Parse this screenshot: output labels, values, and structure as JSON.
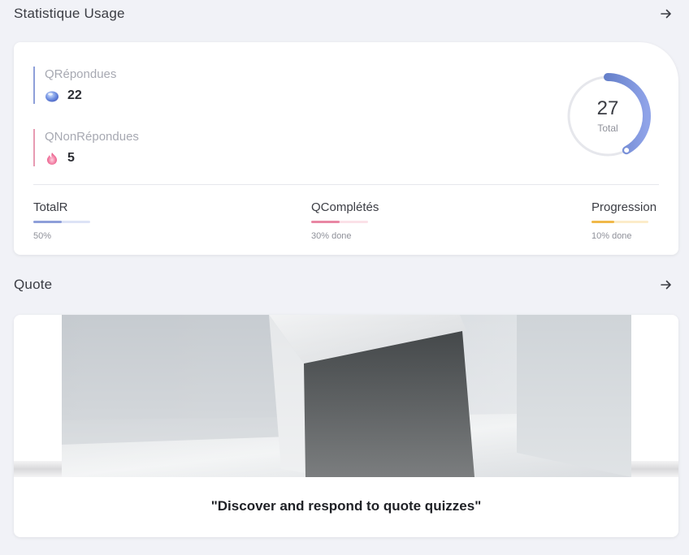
{
  "stats_section": {
    "title": "Statistique Usage",
    "arrow_icon": "arrow-right-icon"
  },
  "stats": [
    {
      "label": "QRépondues",
      "value": "22",
      "icon": "blue-orb-icon",
      "color": "#7d8fd6"
    },
    {
      "label": "QNonRépondues",
      "value": "5",
      "icon": "pink-flame-icon",
      "color": "#e79bb2"
    }
  ],
  "ring": {
    "total": "27",
    "label": "Total",
    "fraction": 0.42,
    "color": "#4f6cb8",
    "track_color": "#e6e7ec"
  },
  "metrics": [
    {
      "label": "TotalR",
      "note": "50%",
      "progress": 0.5,
      "color": "#8e9fd9",
      "track": "#dde3f6"
    },
    {
      "label": "QComplétés",
      "note": "30% done",
      "progress": 0.5,
      "color": "#e987a4",
      "track": "#fbe1e8"
    },
    {
      "label": "Progression",
      "note": "10%  done",
      "progress": 0.4,
      "color": "#f0b949",
      "track": "#fcecc9"
    }
  ],
  "quote_section": {
    "title": "Quote",
    "arrow_icon": "arrow-right-icon"
  },
  "quote": {
    "text": "\"Discover and respond to quote quizzes\"",
    "image": "cube-in-room-image"
  }
}
